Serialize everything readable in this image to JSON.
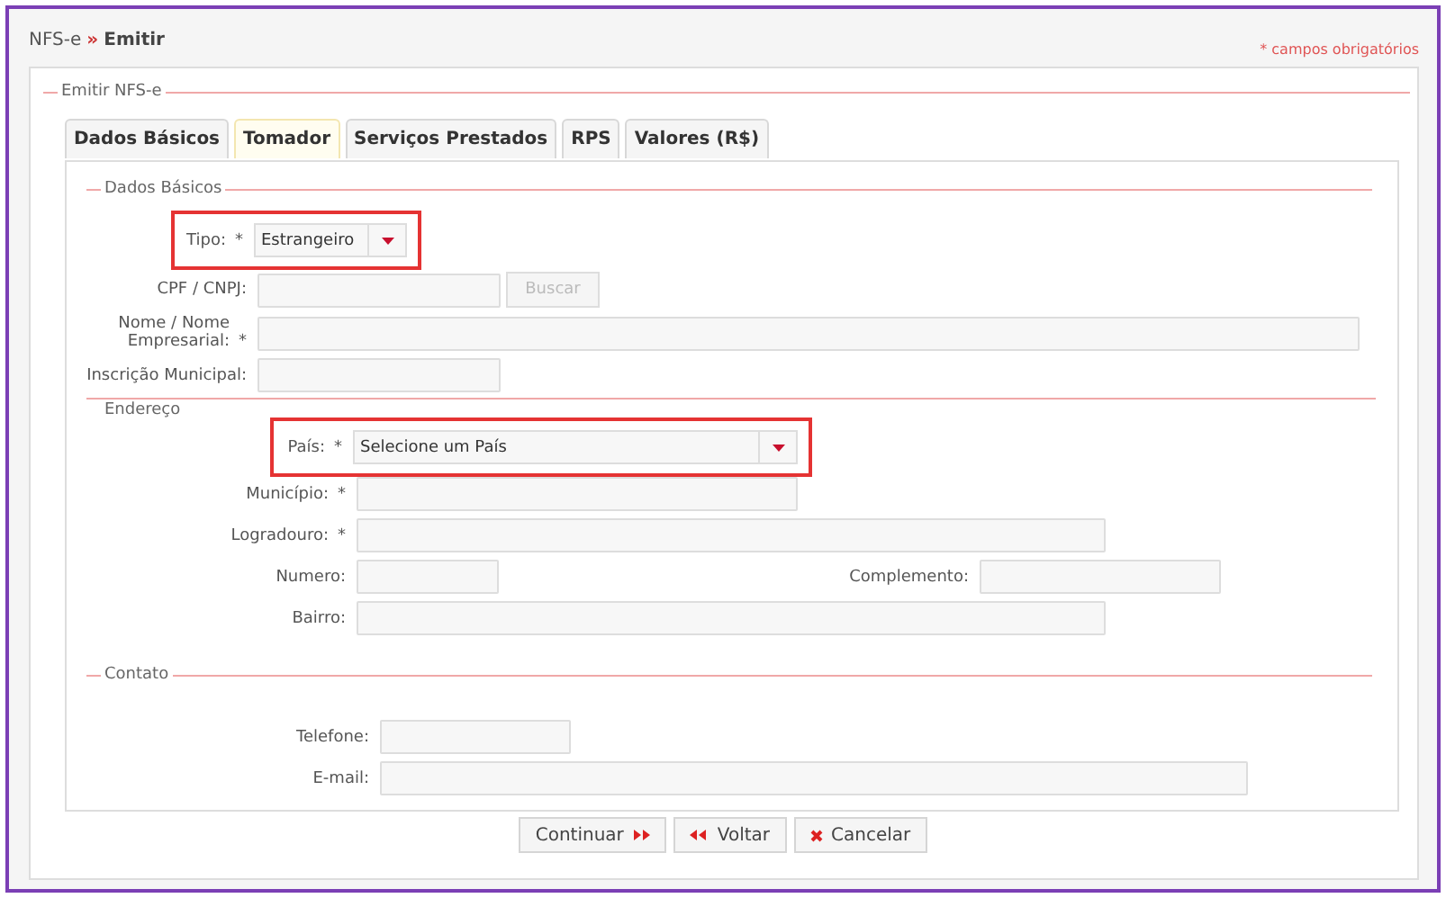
{
  "breadcrumb": {
    "parent": "NFS-e",
    "separator": "»",
    "current": "Emitir"
  },
  "required_note": "* campos obrigatórios",
  "fieldset_title": "Emitir NFS-e",
  "tabs": [
    {
      "label": "Dados Básicos",
      "selected": false
    },
    {
      "label": "Tomador",
      "selected": true
    },
    {
      "label": "Serviços Prestados",
      "selected": false
    },
    {
      "label": "RPS",
      "selected": false
    },
    {
      "label": "Valores (R$)",
      "selected": false
    }
  ],
  "sections": [
    {
      "title": "Dados Básicos",
      "kind": "legend",
      "rows": [
        {
          "highlighted": true,
          "fields": [
            {
              "kind": "select",
              "label": "Tipo:",
              "mark": "*",
              "value": "Estrangeiro"
            }
          ]
        },
        {
          "highlighted": false,
          "fields": [
            {
              "kind": "text",
              "label": "CPF / CNPJ:",
              "button": {
                "label": "Buscar",
                "disabled": true
              }
            }
          ]
        },
        {
          "highlighted": false,
          "fields": [
            {
              "kind": "text",
              "label": "Nome / Nome\nEmpresarial:",
              "mark": "*"
            }
          ]
        },
        {
          "highlighted": false,
          "fields": [
            {
              "kind": "text",
              "label": "Inscrição Municipal:"
            }
          ]
        }
      ]
    },
    {
      "title": "Endereço",
      "kind": "divider",
      "rows": [
        {
          "highlighted": true,
          "fields": [
            {
              "kind": "select",
              "label": "País:",
              "mark": "*",
              "value": "Selecione um País"
            }
          ]
        },
        {
          "highlighted": false,
          "fields": [
            {
              "kind": "text",
              "label": "Município:",
              "mark": "*"
            }
          ]
        },
        {
          "highlighted": false,
          "fields": [
            {
              "kind": "text",
              "label": "Logradouro:",
              "mark": "*"
            }
          ]
        },
        {
          "highlighted": false,
          "fields": [
            {
              "kind": "text",
              "label": "Numero:"
            },
            {
              "kind": "text",
              "label": "Complemento:"
            }
          ]
        },
        {
          "highlighted": false,
          "fields": [
            {
              "kind": "text",
              "label": "Bairro:"
            }
          ]
        }
      ]
    },
    {
      "title": "Contato",
      "kind": "legend",
      "rows": [
        {
          "highlighted": false,
          "fields": [
            {
              "kind": "text",
              "label": "Telefone:"
            }
          ]
        },
        {
          "highlighted": false,
          "fields": [
            {
              "kind": "text",
              "label": "E-mail:"
            }
          ]
        }
      ]
    }
  ],
  "buttons": [
    {
      "label": "Continuar",
      "kind": "forward"
    },
    {
      "label": "Voltar",
      "kind": "back"
    },
    {
      "label": "Cancelar",
      "kind": "cancel"
    }
  ]
}
